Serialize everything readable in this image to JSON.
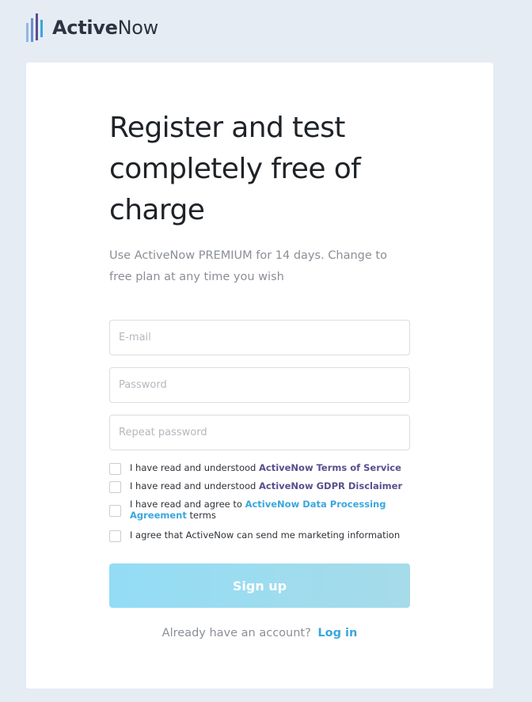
{
  "brand": {
    "name_bold": "Active",
    "name_light": "Now",
    "colors": {
      "bar_purple": "#5b4e8e",
      "bar_blue": "#3aa7dd"
    }
  },
  "headline": "Register and test completely free of charge",
  "subtext": "Use ActiveNow PREMIUM for 14 days. Change to free plan at any time you wish",
  "fields": {
    "email_placeholder": "E-mail",
    "password_placeholder": "Password",
    "repeat_placeholder": "Repeat password"
  },
  "consents": [
    {
      "prefix": "I have read and understood ",
      "link": "ActiveNow Terms of Service",
      "suffix": "",
      "checked": false
    },
    {
      "prefix": "I have read and understood ",
      "link": "ActiveNow GDPR Disclaimer",
      "suffix": "",
      "checked": false
    },
    {
      "prefix": "I have read and agree to ",
      "link": "ActiveNow Data Processing Agreement",
      "suffix": " terms",
      "checked": false
    },
    {
      "prefix": "I agree that ActiveNow can send me marketing information",
      "link": "",
      "suffix": "",
      "checked": false
    }
  ],
  "signup_label": "Sign up",
  "login": {
    "prompt": "Already have an account?",
    "link": "Log in"
  },
  "colors": {
    "page_bg": "#e6ecf4",
    "link_purple": "#5b4e8e",
    "link_blue": "#3aa7dd",
    "button_start": "#93dcf5",
    "button_end": "#a6dbe9"
  }
}
